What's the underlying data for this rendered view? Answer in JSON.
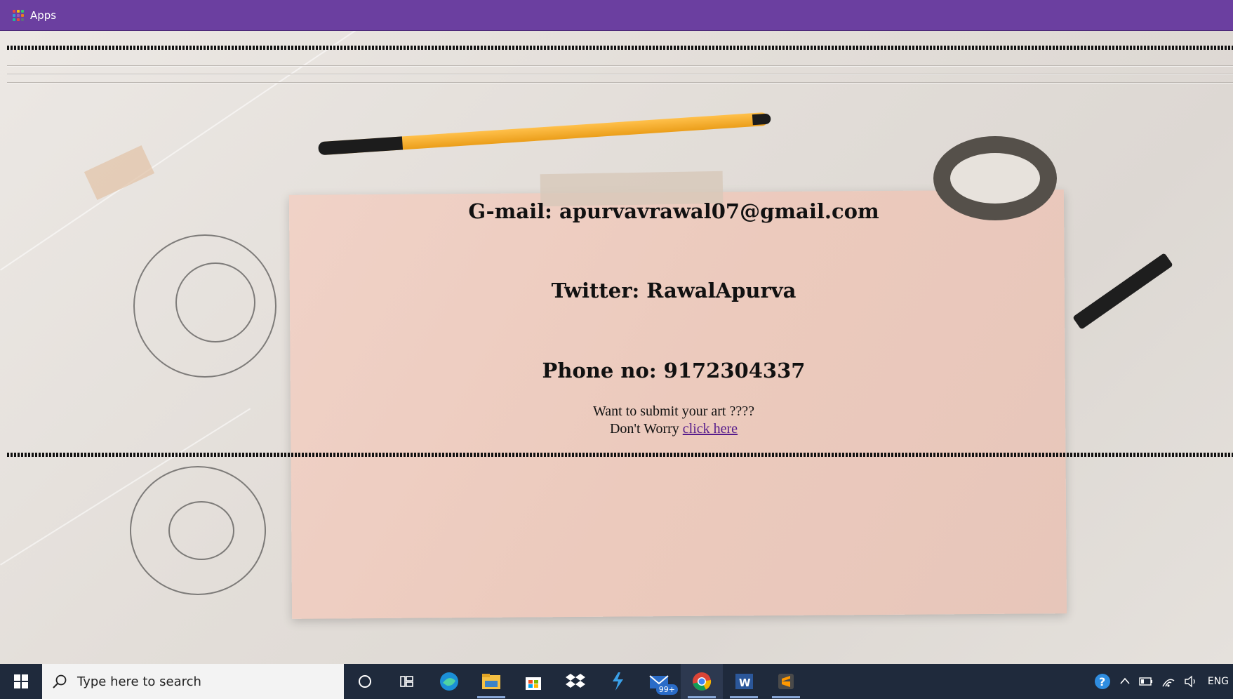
{
  "bookmarks_bar": {
    "apps_label": "Apps",
    "apps_icon_colors": [
      "#e84c3d",
      "#f1c40f",
      "#2ecc71",
      "#3498db",
      "#9b59b6",
      "#e67e22",
      "#1abc9c",
      "#e74c3c",
      "#34495e"
    ]
  },
  "page": {
    "contacts": [
      {
        "text": "G-mail: apurvavrawal07@gmail.com"
      },
      {
        "text": "Twitter: RawalApurva"
      },
      {
        "text": "Phone no: 9172304337"
      }
    ],
    "submit_question": "Want to submit your art ????",
    "submit_prefix": "Don't Worry",
    "submit_link": "click here"
  },
  "taskbar": {
    "search_placeholder": "Type here to search",
    "mail_badge": "99+",
    "language": "ENG",
    "apps": [
      {
        "icon": "cortana-icon"
      },
      {
        "icon": "task-view-icon"
      },
      {
        "icon": "edge-icon"
      },
      {
        "icon": "file-explorer-icon"
      },
      {
        "icon": "store-icon"
      },
      {
        "icon": "dropbox-icon"
      },
      {
        "icon": "visual-studio-icon"
      },
      {
        "icon": "mail-icon"
      },
      {
        "icon": "chrome-icon"
      },
      {
        "icon": "word-icon"
      },
      {
        "icon": "sublime-text-icon"
      }
    ],
    "colors": {
      "accent": "#8aa9d9",
      "taskbar_bg": "#1f2a3c",
      "titlebar_purple": "#6b3fa0",
      "link_visited": "#551a8b"
    }
  }
}
